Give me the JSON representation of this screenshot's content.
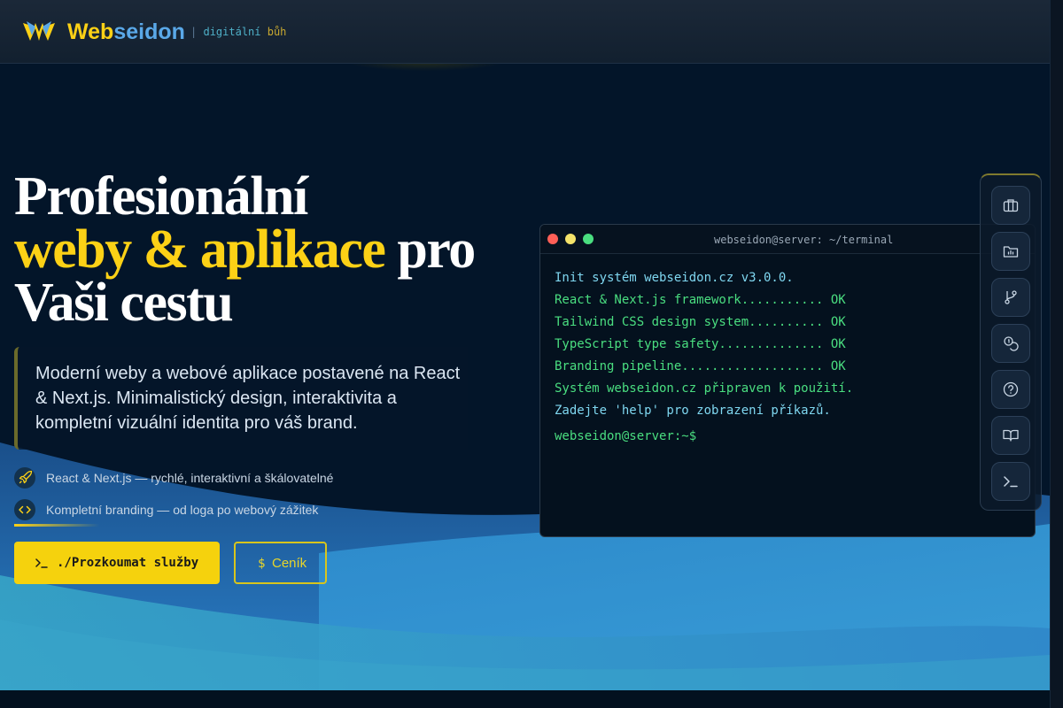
{
  "header": {
    "brand_part1": "Web",
    "brand_part2": "seidon",
    "tagline_sep": "|",
    "tagline_1": "digitální",
    "tagline_2": "bůh",
    "logo_icon": "trident-logo-icon"
  },
  "hero": {
    "title_line1": "Profesionální",
    "title_highlight": "weby & aplikace",
    "title_rest": " pro",
    "title_line3": "Vaši cestu",
    "description": "Moderní weby a webové aplikace postavené na React & Next.js. Minimalistický design, interaktivita a kompletní vizuální identita pro váš brand."
  },
  "features": [
    {
      "icon": "rocket-icon",
      "text": "React & Next.js — rychlé, interaktivní a škálovatelné"
    },
    {
      "icon": "code-icon",
      "text": "Kompletní branding — od loga po webový zážitek"
    }
  ],
  "buttons": {
    "primary_label": "./Prozkoumat služby",
    "primary_icon": "terminal-prompt-icon",
    "secondary_prefix": "$",
    "secondary_label": "Ceník"
  },
  "terminal": {
    "title": "webseidon@server: ~/terminal",
    "lines": [
      "Init systém webseidon.cz v3.0.0.",
      "React & Next.js framework........... OK",
      "Tailwind CSS design system.......... OK",
      "TypeScript type safety.............. OK",
      "Branding pipeline................... OK",
      "Systém webseidon.cz připraven k použití.",
      "Zadejte 'help' pro zobrazení příkazů."
    ],
    "prompt": "webseidon@server:~$"
  },
  "sidebar": {
    "items": [
      {
        "icon": "briefcase-icon"
      },
      {
        "icon": "folder-chart-icon"
      },
      {
        "icon": "git-branch-icon"
      },
      {
        "icon": "coins-icon"
      },
      {
        "icon": "help-circle-icon"
      },
      {
        "icon": "book-open-icon"
      },
      {
        "icon": "terminal-icon"
      }
    ]
  },
  "colors": {
    "accent": "#fcd116",
    "brand_blue": "#5aa8e8",
    "terminal_green": "#4ade80",
    "terminal_cyan": "#7fd7f0",
    "background": "#031529"
  }
}
